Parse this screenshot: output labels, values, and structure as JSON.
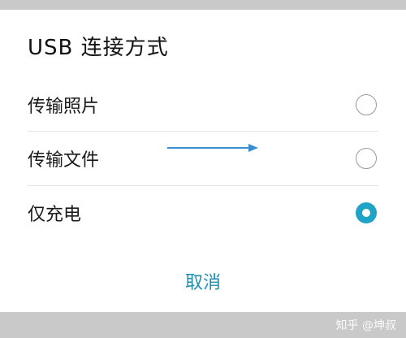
{
  "dialog": {
    "title": "USB 连接方式",
    "options": [
      {
        "label": "传输照片",
        "selected": false
      },
      {
        "label": "传输文件",
        "selected": false
      },
      {
        "label": "仅充电",
        "selected": true
      }
    ],
    "cancel_label": "取消"
  },
  "watermark": "知乎 @坤叔",
  "colors": {
    "accent": "#1fa3c6",
    "cancel_text": "#1f8fb0",
    "arrow": "#3a8ed0",
    "radio_border": "#9a9a9a",
    "background_strip": "#c9c9c9"
  },
  "icons": {
    "annotation": "arrow-right-icon"
  }
}
